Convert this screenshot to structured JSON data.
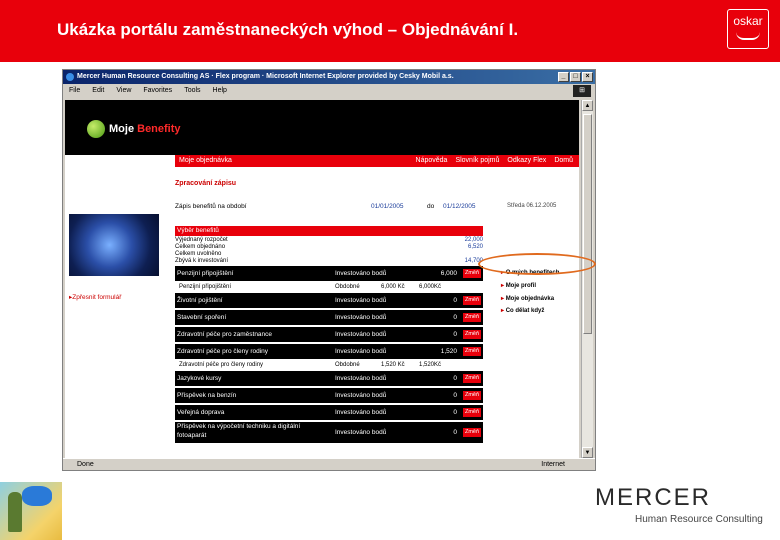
{
  "header": {
    "title": "Ukázka portálu zaměstnaneckých výhod – Objednávání I.",
    "logo_text": "oskar",
    "background": "#e8000b"
  },
  "browser": {
    "title": "Mercer Human Resource Consulting AS · Flex program · Microsoft Internet Explorer provided by Cesky Mobil a.s.",
    "menu": [
      "File",
      "Edit",
      "View",
      "Favorites",
      "Tools",
      "Help"
    ],
    "status": "Done",
    "status_zone": "Internet"
  },
  "site": {
    "logo_main": "Moje",
    "logo_accent": " Benefity",
    "nav_left": "Moje objednávka",
    "nav_right": [
      "Nápověda",
      "Slovník pojmů",
      "Odkazy Flex",
      "Domů"
    ],
    "left_link": "Zpřesnit formulář",
    "content_title": "Zpracování zápisu",
    "period_label": "Zápis benefitů na období",
    "period_from": "01/01/2005",
    "period_do": "do",
    "period_to": "01/12/2005",
    "vyber_label": "Výběr benefitů",
    "sums": [
      {
        "label": "Výjednaný rozpočet",
        "value": "22,000"
      },
      {
        "label": "Celkem objednáno",
        "value": "6,520"
      },
      {
        "label": "Celkem uvolněno",
        "value": ""
      },
      {
        "label": "Zbývá k investování",
        "value": "14,700"
      }
    ],
    "benefits": [
      {
        "name": "Penzijní připojištění",
        "mode": "Investováno bodů",
        "amount": "6,000",
        "btn": "Změň"
      },
      {
        "name": "Životní pojištění",
        "mode": "Investováno bodů",
        "amount": "0",
        "btn": "Změň"
      },
      {
        "name": "Stavební spoření",
        "mode": "Investováno bodů",
        "amount": "0",
        "btn": "Změň"
      },
      {
        "name": "Zdravotní péče pro zaměstnance",
        "mode": "Investováno bodů",
        "amount": "0",
        "btn": "Změň"
      },
      {
        "name": "Zdravotní péče pro členy rodiny",
        "mode": "Investováno bodů",
        "amount": "1,520",
        "btn": "Změň"
      },
      {
        "name": "Jazykové kursy",
        "mode": "Investováno bodů",
        "amount": "0",
        "btn": "Změň"
      },
      {
        "name": "Příspěvek na benzín",
        "mode": "Investováno bodů",
        "amount": "0",
        "btn": "Změň"
      },
      {
        "name": "Veřejná doprava",
        "mode": "Investováno bodů",
        "amount": "0",
        "btn": "Změň"
      },
      {
        "name": "Příspěvek na výpočetní techniku a digitální fotoaparát",
        "mode": "Investováno bodů",
        "amount": "0",
        "btn": "Změň"
      }
    ],
    "sub_rows": [
      {
        "name": "Penzijní připojištění",
        "mode": "Obdobné",
        "x": "6,000 Kč",
        "amount": "6,000Kč"
      },
      {
        "name": "Zdravotní péče pro členy rodiny",
        "mode": "Obdobné",
        "x": "1,520 Kč",
        "amount": "1,520Kč"
      }
    ],
    "right_date": "Středa 06.12.2005",
    "right_items": [
      "O mých benefitech",
      "Moje profil",
      "Moje objednávka",
      "Co dělat když"
    ]
  },
  "footer": {
    "company": "MERCER",
    "company_sub": "Human Resource Consulting"
  },
  "colors": {
    "accent_red": "#e8000b",
    "annotation_orange": "#e06a1e",
    "link_blue": "#1a3c9a"
  }
}
